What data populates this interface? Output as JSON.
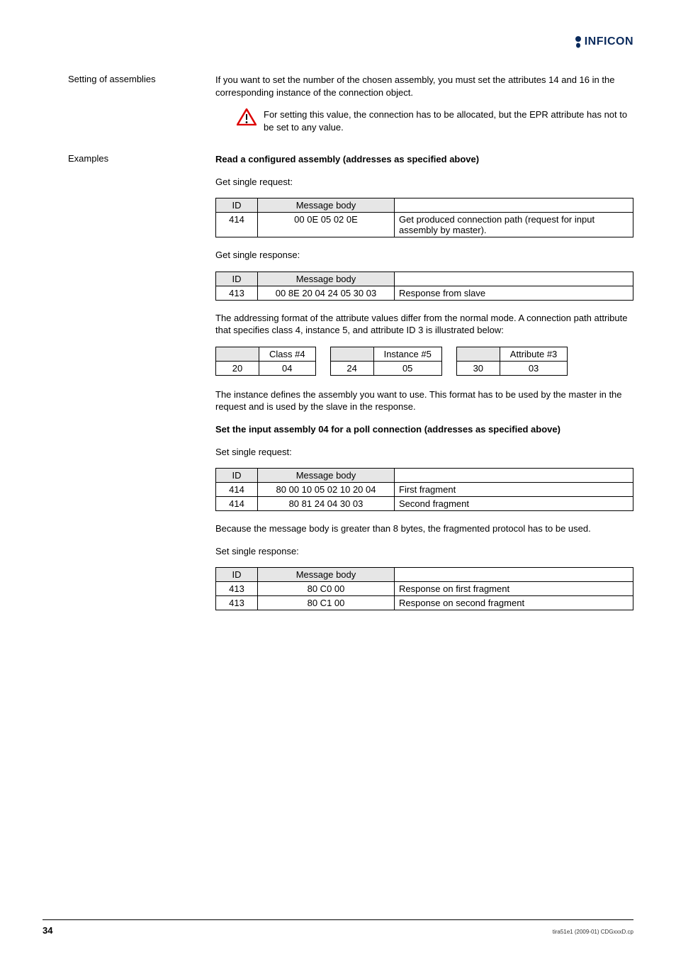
{
  "logo_text": "INFICON",
  "side": {
    "setting": "Setting of assemblies",
    "examples": "Examples"
  },
  "intro": "If you want to set the number of the chosen assembly, you must set the attributes 14 and 16 in the corresponding instance of the connection object.",
  "note": "For setting this value, the connection has to be allocated, but the EPR attribute has not to be set to any value.",
  "sec1": {
    "heading": "Read a configured assembly (addresses as specified above)",
    "get_req": "Get single request:",
    "get_resp": "Get single response:",
    "hdr_id": "ID",
    "hdr_body": "Message body",
    "req_id": "414",
    "req_body": "00 0E 05 02 0E",
    "req_desc": "Get produced connection path (request for input assembly by master).",
    "resp_id": "413",
    "resp_body": "00 8E 20 04 24 05 30 03",
    "resp_desc": "Response from slave"
  },
  "addr_text": "The addressing format of the attribute values differ from the normal mode. A connection path attribute that specifies class 4, instance 5, and attribute ID 3 is illustrated below:",
  "small": {
    "class_h": "Class #4",
    "class_l": "20",
    "class_v": "04",
    "inst_h": "Instance #5",
    "inst_l": "24",
    "inst_v": "05",
    "attr_h": "Attribute #3",
    "attr_l": "30",
    "attr_v": "03"
  },
  "inst_text": "The instance defines the assembly you want to use. This format has to be used by the master in the request and is used by the slave in the response.",
  "sec2": {
    "heading": "Set the input assembly 04 for a poll connection (addresses as specified above)",
    "set_req": "Set single request:",
    "req1_id": "414",
    "req1_body": "80 00 10 05 02 10 20 04",
    "req1_desc": "First fragment",
    "req2_id": "414",
    "req2_body": "80 81 24 04 30 03",
    "req2_desc": "Second fragment",
    "frag_note": "Because the message body is greater than 8 bytes, the fragmented protocol has to be used.",
    "set_resp": "Set single response:",
    "resp1_id": "413",
    "resp1_body": "80 C0 00",
    "resp1_desc": "Response on first fragment",
    "resp2_id": "413",
    "resp2_body": "80 C1 00",
    "resp2_desc": "Response on second fragment"
  },
  "footer": {
    "page": "34",
    "right": "tira51e1    (2009-01)    CDGxxxD.cp"
  }
}
